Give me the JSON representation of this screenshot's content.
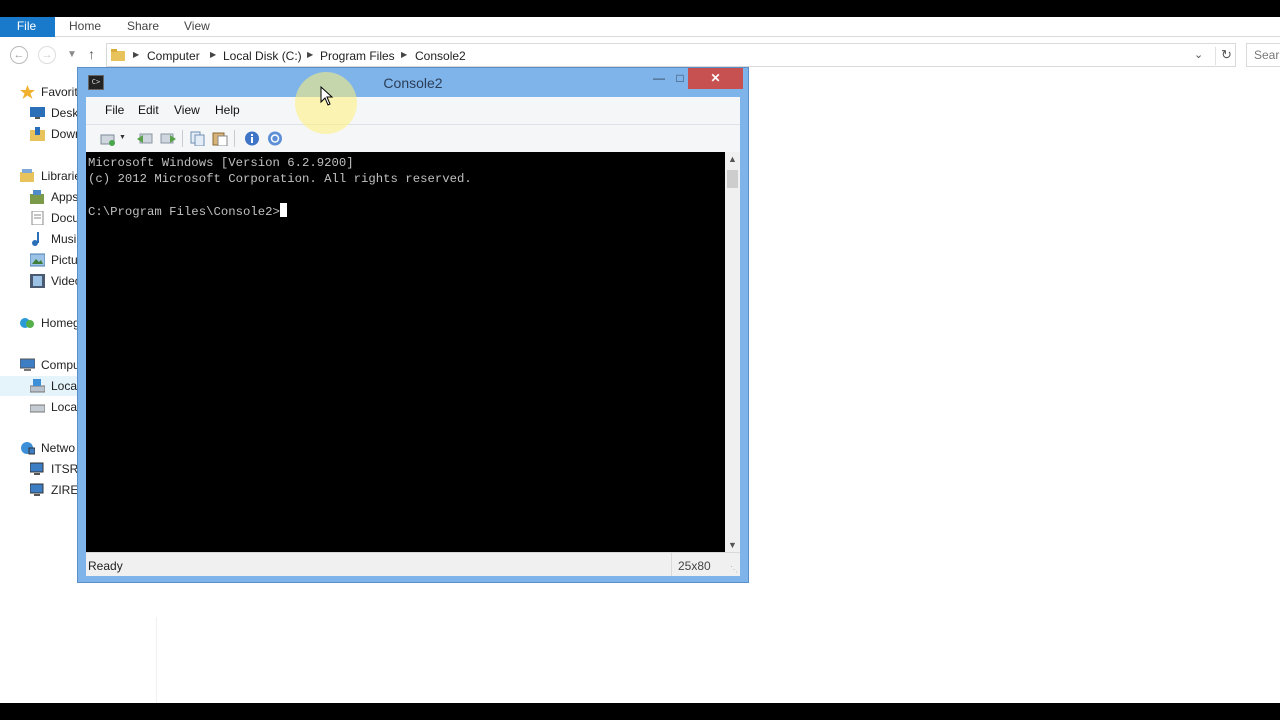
{
  "explorer": {
    "ribbon_tabs": [
      "File",
      "Home",
      "Share",
      "View"
    ],
    "breadcrumb": [
      "Computer",
      "Local Disk (C:)",
      "Program Files",
      "Console2"
    ],
    "search_placeholder": "Sear",
    "nav_items": [
      {
        "label": "Favorit",
        "icon": "star-icon",
        "level": 0
      },
      {
        "label": "Deskt",
        "icon": "desktop-icon",
        "level": 1
      },
      {
        "label": "Down",
        "icon": "downloads-folder-icon",
        "level": 1
      },
      {
        "label": "Librarie",
        "icon": "libraries-icon",
        "level": 0
      },
      {
        "label": "Apps",
        "icon": "apps-icon",
        "level": 1
      },
      {
        "label": "Docu",
        "icon": "documents-icon",
        "level": 1
      },
      {
        "label": "Musi",
        "icon": "music-icon",
        "level": 1
      },
      {
        "label": "Pictu",
        "icon": "pictures-icon",
        "level": 1
      },
      {
        "label": "Video",
        "icon": "videos-icon",
        "level": 1
      },
      {
        "label": "Homeg",
        "icon": "homegroup-icon",
        "level": 0
      },
      {
        "label": "Compu",
        "icon": "computer-icon",
        "level": 0
      },
      {
        "label": "Local",
        "icon": "drive-c-icon",
        "level": 1,
        "selected": true
      },
      {
        "label": "Local",
        "icon": "drive-icon",
        "level": 1
      },
      {
        "label": "Netwo",
        "icon": "network-icon",
        "level": 0
      },
      {
        "label": "ITSRA",
        "icon": "network-computer-icon",
        "level": 1
      },
      {
        "label": "ZIREN",
        "icon": "network-computer-icon",
        "level": 1
      }
    ]
  },
  "console": {
    "title": "Console2",
    "app_icon_text": "C>",
    "menu": [
      "File",
      "Edit",
      "View",
      "Help"
    ],
    "toolbar_icons": [
      "new-tab-icon",
      "dropdown-arrow-icon",
      "previous-tab-icon",
      "next-tab-icon",
      "copy-icon",
      "paste-icon",
      "info-icon",
      "help-icon"
    ],
    "terminal_lines": [
      "Microsoft Windows [Version 6.2.9200]",
      "(c) 2012 Microsoft Corporation. All rights reserved.",
      "",
      "C:\\Program Files\\Console2>"
    ],
    "status": "Ready",
    "dimensions": "25x80"
  }
}
